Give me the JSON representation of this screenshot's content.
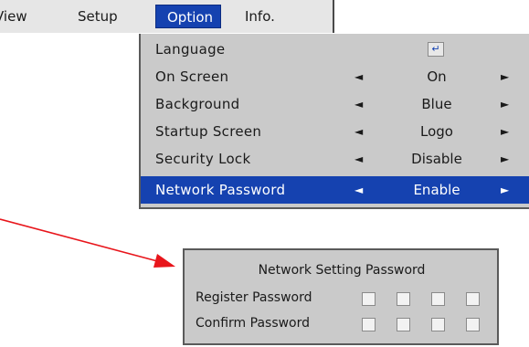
{
  "menubar": {
    "tabs": [
      {
        "label": "View"
      },
      {
        "label": "Setup"
      },
      {
        "label": "Option"
      },
      {
        "label": "Info."
      }
    ]
  },
  "option_menu": {
    "items": [
      {
        "label": "Language",
        "value": "",
        "icon": "enter-icon"
      },
      {
        "label": "On Screen",
        "value": "On"
      },
      {
        "label": "Background",
        "value": "Blue"
      },
      {
        "label": "Startup Screen",
        "value": "Logo"
      },
      {
        "label": "Security Lock",
        "value": "Disable"
      },
      {
        "label": "Network Password",
        "value": "Enable"
      }
    ],
    "arrow_left": "◄",
    "arrow_right": "►",
    "enter_glyph": "↵"
  },
  "dialog": {
    "title": "Network Setting Password",
    "register_label": "Register Password",
    "confirm_label": "Confirm Password"
  },
  "colors": {
    "highlight": "#1542b0",
    "panel": "#cacaca",
    "annotation": "#e8151b"
  }
}
